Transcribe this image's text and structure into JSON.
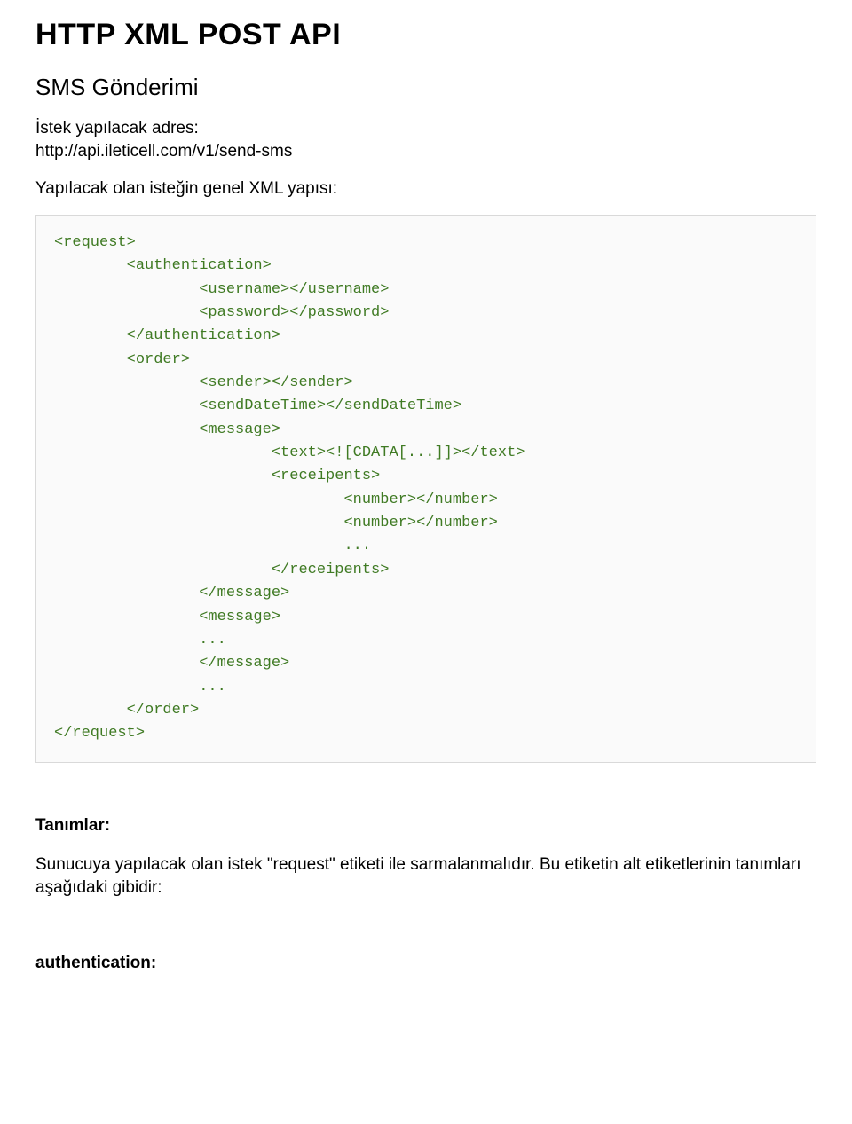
{
  "title": "HTTP XML POST API",
  "subtitle": "SMS Gönderimi",
  "request_label": "İstek yapılacak adres:",
  "request_url": "http://api.ileticell.com/v1/send-sms",
  "xml_heading": "Yapılacak olan isteğin genel XML yapısı:",
  "code": "<request>\n        <authentication>\n                <username></username>\n                <password></password>\n        </authentication>\n        <order>\n                <sender></sender>\n                <sendDateTime></sendDateTime>\n                <message>\n                        <text><![CDATA[...]]></text>\n                        <receipents>\n                                <number></number>\n                                <number></number>\n                                ...\n                        </receipents>\n                </message>\n                <message>\n                ...\n                </message>\n                ...\n        </order>\n</request>",
  "definitions_heading": "Tanımlar:",
  "definitions_body": "Sunucuya yapılacak olan istek \"request\" etiketi ile sarmalanmalıdır. Bu etiketin alt etiketlerinin tanımları aşağıdaki gibidir:",
  "field_1": "authentication:"
}
